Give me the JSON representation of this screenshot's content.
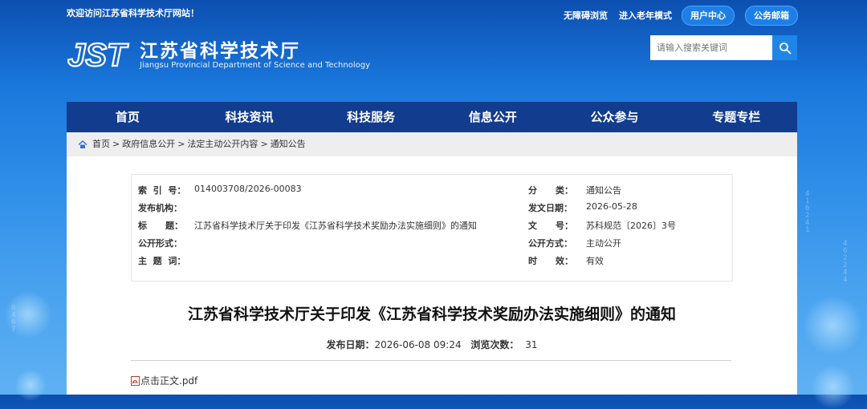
{
  "topbar": {
    "welcome": "欢迎访问江苏省科学技术厅网站！",
    "accessible": "无障碍浏览",
    "elder_mode": "进入老年模式",
    "user_center": "用户中心",
    "mail": "公务邮箱"
  },
  "logo": {
    "abbr": "JST",
    "name_cn": "江苏省科学技术厅",
    "name_en": "Jiangsu Provincial Department of Science and Technology"
  },
  "search": {
    "placeholder": "请输入搜索关键词"
  },
  "nav": [
    "首页",
    "科技资讯",
    "科技服务",
    "信息公开",
    "公众参与",
    "专题专栏"
  ],
  "breadcrumb": [
    "首页",
    "政府信息公开",
    "法定主动公开内容",
    "通知公告"
  ],
  "breadcrumb_sep": ">",
  "meta": {
    "index_label": "索  引  号：",
    "index_value": "014003708/2026-00083",
    "category_label": "分      类：",
    "category_value": "通知公告",
    "publisher_label": "发布机构：",
    "publisher_value": "",
    "date_label": "发文日期：",
    "date_value": "2026-05-28",
    "title_label": "标      题：",
    "title_value": "江苏省科学技术厅关于印发《江苏省科学技术奖励办法实施细则》的通知",
    "docno_label": "文      号：",
    "docno_value": "苏科规范〔2026〕3号",
    "form_label": "公开形式：",
    "form_value": "",
    "mode_label": "公开方式：",
    "mode_value": "主动公开",
    "subject_label": "主  题  词：",
    "subject_value": "",
    "validity_label": "时      效：",
    "validity_value": "有效"
  },
  "article": {
    "title": "江苏省科学技术厅关于印发《江苏省科学技术奖励办法实施细则》的通知",
    "pub_label": "发布日期：",
    "pub_date": "2026-06-08 09:24",
    "views_label": "浏览次数：",
    "views": "31",
    "attachment": "点击正文.pdf"
  },
  "colors": {
    "nav_bg": "#123c8e",
    "accent": "#1f86e8"
  },
  "icons": [
    "home-icon",
    "search-icon",
    "pdf-icon"
  ]
}
